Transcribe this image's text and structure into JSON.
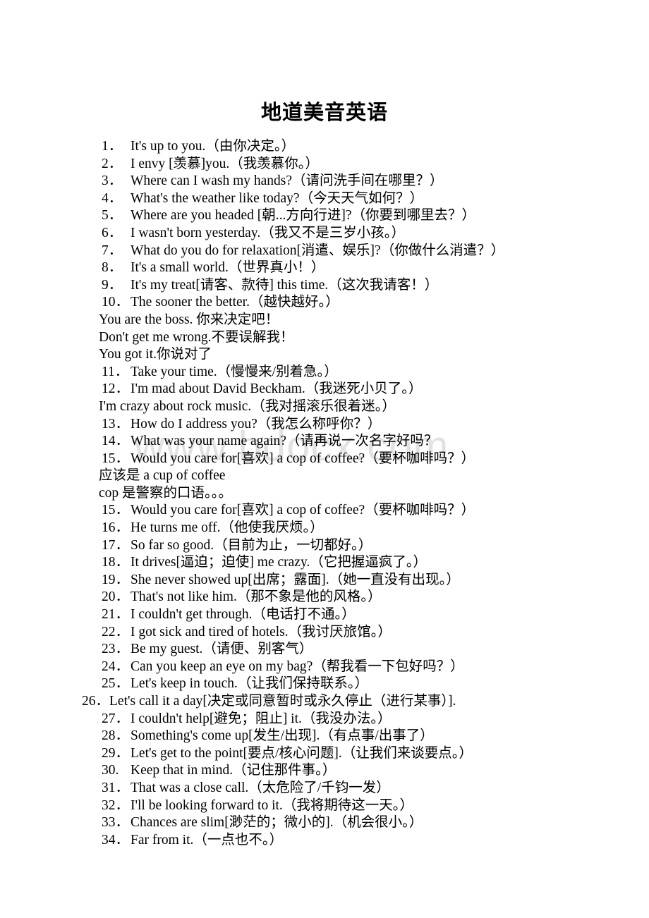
{
  "document": {
    "title": "地道美音英语",
    "watermark": "www.bdocx.com",
    "background_color": "#ffffff",
    "text_color": "#000000",
    "watermark_color": "#e2e2e2"
  },
  "lines": [
    {
      "kind": "numbered",
      "num": "1．",
      "text": "It's up to you.（由你决定。）"
    },
    {
      "kind": "numbered",
      "num": "2．",
      "text": "I envy [羡慕]you.（我羡慕你。）"
    },
    {
      "kind": "numbered",
      "num": "3．",
      "text": "Where can I wash my hands?（请问洗手间在哪里？）"
    },
    {
      "kind": "numbered",
      "num": "4．",
      "text": "What's the weather like today?（今天天气如何？）"
    },
    {
      "kind": "numbered",
      "num": "5．",
      "text": "Where are you headed [朝...方向行进]?（你要到哪里去？）"
    },
    {
      "kind": "numbered",
      "num": "6．",
      "text": "I wasn't born yesterday.（我又不是三岁小孩。）"
    },
    {
      "kind": "numbered",
      "num": "7．",
      "text": "What do you do for relaxation[消遣、娱乐]?（你做什么消遣？）"
    },
    {
      "kind": "numbered",
      "num": "8．",
      "text": "It's a small world.（世界真小！）"
    },
    {
      "kind": "numbered",
      "num": "9．",
      "text": "It's my treat[请客、款待] this time.（这次我请客！）"
    },
    {
      "kind": "numbered",
      "num": "10．",
      "text": "The sooner the better.（越快越好。）"
    },
    {
      "kind": "plain",
      "num": "",
      "text": "You are the boss. 你来决定吧！"
    },
    {
      "kind": "plain",
      "num": "",
      "text": "Don't get me wrong.不要误解我！"
    },
    {
      "kind": "plain",
      "num": "",
      "text": "You got it.你说对了"
    },
    {
      "kind": "numbered",
      "num": "11．",
      "text": "Take your time.（慢慢来/别着急。）"
    },
    {
      "kind": "numbered",
      "num": "12．",
      "text": "I'm mad about David Beckham.（我迷死小贝了。）"
    },
    {
      "kind": "plain",
      "num": "",
      "text": "I'm crazy about rock music.（我对摇滚乐很着迷。）"
    },
    {
      "kind": "numbered",
      "num": "13．",
      "text": "How do I address you?（我怎么称呼你？）"
    },
    {
      "kind": "numbered",
      "num": "14．",
      "text": "What was your name again?（请再说一次名字好吗？"
    },
    {
      "kind": "numbered",
      "num": "15．",
      "text": "Would you care for[喜欢] a cop of coffee?（要杯咖啡吗？）"
    },
    {
      "kind": "plain",
      "num": "",
      "text": "应该是 a cup of coffee"
    },
    {
      "kind": "plain",
      "num": "",
      "text": "cop 是警察的口语。。。"
    },
    {
      "kind": "numbered",
      "num": "15．",
      "text": "Would you care for[喜欢] a cop of coffee?（要杯咖啡吗？）"
    },
    {
      "kind": "numbered",
      "num": "16．",
      "text": "He turns me off.（他使我厌烦。）"
    },
    {
      "kind": "numbered",
      "num": "17．",
      "text": "So far so good.（目前为止，一切都好。）"
    },
    {
      "kind": "numbered",
      "num": "18．",
      "text": "It drives[逼迫；迫使] me crazy.（它把握逼疯了。）"
    },
    {
      "kind": "numbered",
      "num": "19．",
      "text": "She never showed up[出席；露面].（她一直没有出现。）"
    },
    {
      "kind": "numbered",
      "num": "20．",
      "text": "That's not like him.（那不象是他的风格。）"
    },
    {
      "kind": "numbered",
      "num": "21．",
      "text": "I couldn't get through.（电话打不通。）"
    },
    {
      "kind": "numbered",
      "num": "22．",
      "text": "I got sick and tired of hotels.（我讨厌旅馆。）"
    },
    {
      "kind": "numbered",
      "num": "23．",
      "text": "Be my guest.（请便、别客气）"
    },
    {
      "kind": "numbered",
      "num": "24．",
      "text": "Can you keep an eye on my bag?（帮我看一下包好吗？）"
    },
    {
      "kind": "numbered",
      "num": "25．",
      "text": "Let's keep in touch.（让我们保持联系。）"
    },
    {
      "kind": "numbered-wide",
      "num": "26．",
      "text": "Let's call it a day[决定或同意暂时或永久停止（进行某事）]."
    },
    {
      "kind": "numbered",
      "num": "27．",
      "text": "I couldn't help[避免；阻止] it.（我没办法。）"
    },
    {
      "kind": "numbered",
      "num": "28．",
      "text": "Something's come up[发生/出现].（有点事/出事了）"
    },
    {
      "kind": "numbered",
      "num": "29．",
      "text": "Let's get to the point[要点/核心问题].（让我们来谈要点。）"
    },
    {
      "kind": "numbered",
      "num": "30.",
      "text": "Keep that in mind.（记住那件事。）"
    },
    {
      "kind": "numbered",
      "num": "31．",
      "text": "That was a close call.（太危险了/千钧一发）"
    },
    {
      "kind": "numbered",
      "num": "32．",
      "text": "I'll be looking forward to it.（我将期待这一天。）"
    },
    {
      "kind": "numbered",
      "num": "33．",
      "text": "Chances are slim[渺茫的；微小的].（机会很小。）"
    },
    {
      "kind": "numbered",
      "num": "34．",
      "text": "Far from it.（一点也不。）"
    }
  ]
}
